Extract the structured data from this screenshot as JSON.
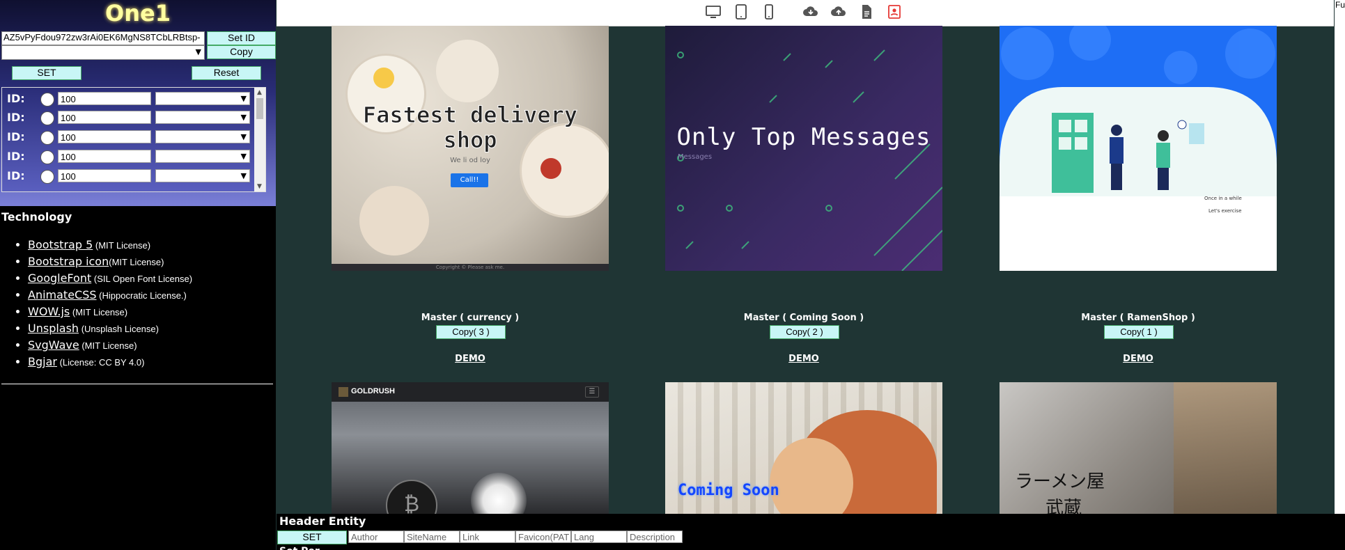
{
  "app_title": "One1",
  "token": {
    "value": "AZ5vPyFdou972zw3rAi0EK6MgNS8TCbLRBtsp-",
    "set_id_label": "Set ID",
    "copy_label": "Copy"
  },
  "controls": {
    "set_label": "SET",
    "reset_label": "Reset"
  },
  "id_rows": [
    {
      "label": "ID:",
      "value": "100"
    },
    {
      "label": "ID:",
      "value": "100"
    },
    {
      "label": "ID:",
      "value": "100"
    },
    {
      "label": "ID:",
      "value": "100"
    },
    {
      "label": "ID:",
      "value": "100"
    }
  ],
  "technology": {
    "title": "Technology",
    "items": [
      {
        "name": "Bootstrap 5",
        "license": " (MIT License)"
      },
      {
        "name": "Bootstrap icon",
        "license": "(MIT License)"
      },
      {
        "name": "GoogleFont",
        "license": " (SIL Open Font License)"
      },
      {
        "name": "AnimateCSS",
        "license": " (Hippocratic License.)"
      },
      {
        "name": "WOW.js",
        "license": " (MIT License)"
      },
      {
        "name": "Unsplash",
        "license": " (Unsplash License)"
      },
      {
        "name": "SvgWave",
        "license": " (MIT License)"
      },
      {
        "name": "Bgjar",
        "license": " (License: CC BY 4.0)"
      }
    ]
  },
  "toolbar_icons": [
    "desktop-icon",
    "tablet-icon",
    "phone-icon",
    "cloud-download-icon",
    "cloud-upload-icon",
    "file-text-icon",
    "person-badge-icon"
  ],
  "right_edge_text": "Fu",
  "cards": [
    {
      "name": "Master ( currency )",
      "copy_label": "Copy( 3 )",
      "demo_label": "DEMO",
      "preview_title": "Fastest delivery shop",
      "preview_sub": "We li        od        loy",
      "preview_button": "Call!!",
      "preview_footer": "Copyright © Please ask me."
    },
    {
      "name": "Master ( Coming Soon )",
      "copy_label": "Copy( 2 )",
      "demo_label": "DEMO",
      "preview_title": "Only Top Messages",
      "preview_sub": "Messages"
    },
    {
      "name": "Master ( RamenShop )",
      "copy_label": "Copy( 1 )",
      "demo_label": "DEMO",
      "preview_note1": "Once in a while",
      "preview_note2": "Let's exercise"
    },
    {
      "preview_brand": "GOLDRUSH"
    },
    {
      "preview_title": "Coming Soon"
    },
    {
      "preview_title1": "ラーメン屋",
      "preview_title2": "武蔵"
    }
  ],
  "header_entity": {
    "title": "Header Entity",
    "set_label": "SET",
    "fields": [
      "Author",
      "SiteName",
      "Link",
      "Favicon(PAT",
      "Lang",
      "Description"
    ],
    "subtitle": "Set Per... "
  },
  "colors": {
    "accent_button": "#c8f6f6",
    "title_glow": "#ffffa0",
    "page_bg": "#1f3534",
    "record_icon": "#e53935"
  }
}
